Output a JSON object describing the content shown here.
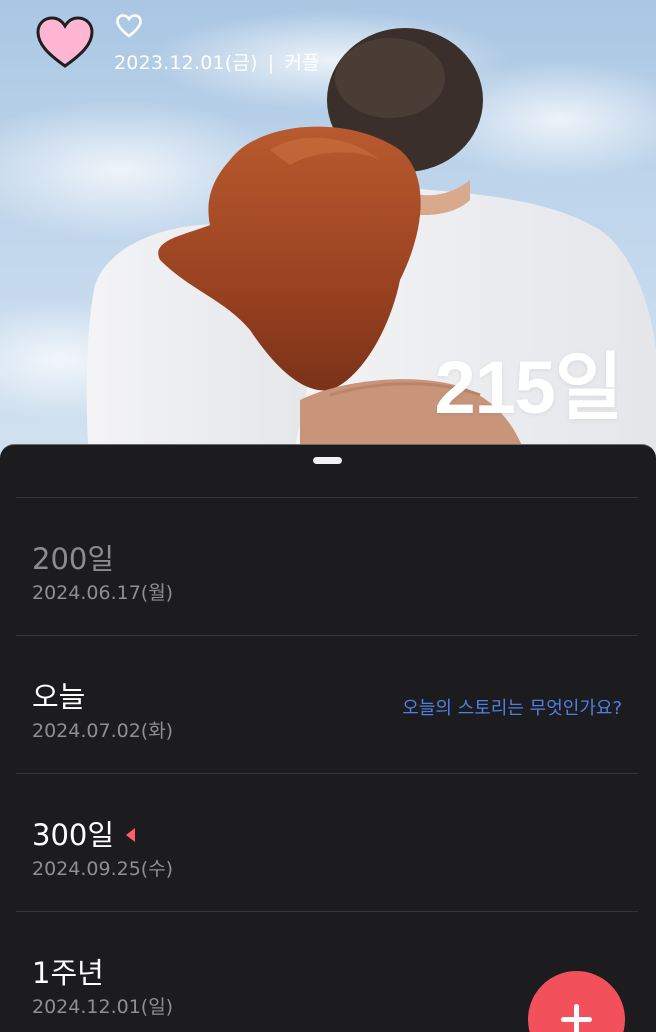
{
  "header": {
    "start_date": "2023.12.01(금)",
    "separator": "|",
    "relation": "커플",
    "day_count": "215일"
  },
  "icons": {
    "big_heart": "heart-filled-pink",
    "small_heart": "heart-outline-white",
    "fab": "plus-icon"
  },
  "anniversaries": [
    {
      "title": "200일",
      "date": "2024.06.17(월)",
      "state": "past"
    },
    {
      "title": "오늘",
      "date": "2024.07.02(화)",
      "state": "today",
      "link": "오늘의 스토리는 무엇인가요?"
    },
    {
      "title": "300일",
      "date": "2024.09.25(수)",
      "state": "next"
    },
    {
      "title": "1주년",
      "date": "2024.12.01(일)",
      "state": "future"
    }
  ],
  "colors": {
    "accent": "#f2515c",
    "heart_pink": "#ffb6d2",
    "link_blue": "#4f7fe6",
    "sheet_bg": "#1c1c1f"
  }
}
